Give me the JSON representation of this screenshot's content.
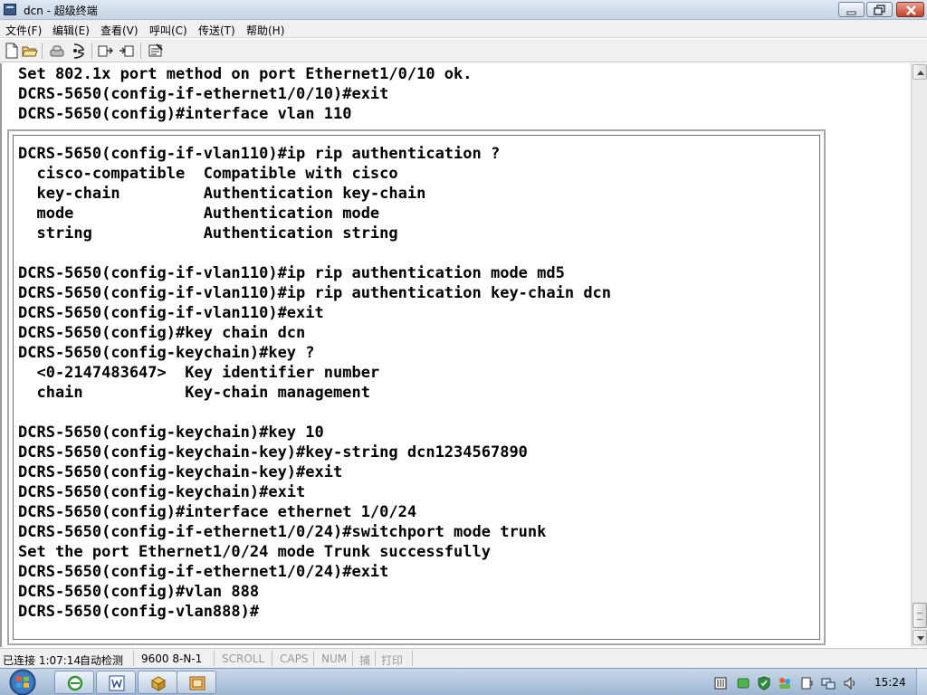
{
  "window": {
    "title": "dcn - 超级终端",
    "minimize_label": "",
    "maximize_label": "",
    "close_label": ""
  },
  "menu": {
    "items": [
      "文件(F)",
      "编辑(E)",
      "查看(V)",
      "呼叫(C)",
      "传送(T)",
      "帮助(H)"
    ]
  },
  "toolbar": {
    "buttons": [
      "new-icon",
      "open-icon",
      "disconnect-icon",
      "dial-icon",
      "send-icon",
      "receive-icon",
      "properties-icon"
    ]
  },
  "terminal": {
    "background_lines": [
      "Set 802.1x port method on port Ethernet1/0/10 ok.",
      "DCRS-5650(config-if-ethernet1/0/10)#exit",
      "DCRS-5650(config)#interface vlan 110"
    ],
    "inner_lines": [
      "DCRS-5650(config-if-vlan110)#ip rip authentication ?",
      "  cisco-compatible  Compatible with cisco",
      "  key-chain         Authentication key-chain",
      "  mode              Authentication mode",
      "  string            Authentication string",
      "",
      "DCRS-5650(config-if-vlan110)#ip rip authentication mode md5",
      "DCRS-5650(config-if-vlan110)#ip rip authentication key-chain dcn",
      "DCRS-5650(config-if-vlan110)#exit",
      "DCRS-5650(config)#key chain dcn",
      "DCRS-5650(config-keychain)#key ?",
      "  <0-2147483647>  Key identifier number",
      "  chain           Key-chain management",
      "",
      "DCRS-5650(config-keychain)#key 10",
      "DCRS-5650(config-keychain-key)#key-string dcn1234567890",
      "DCRS-5650(config-keychain-key)#exit",
      "DCRS-5650(config-keychain)#exit",
      "DCRS-5650(config)#interface ethernet 1/0/24",
      "DCRS-5650(config-if-ethernet1/0/24)#switchport mode trunk",
      "Set the port Ethernet1/0/24 mode Trunk successfully",
      "DCRS-5650(config-if-ethernet1/0/24)#exit",
      "DCRS-5650(config)#vlan 888",
      "DCRS-5650(config-vlan888)#"
    ]
  },
  "statusbar": {
    "connection": "已连接 1:07:14",
    "detect": "自动检测",
    "baud": "9600 8-N-1",
    "scroll": "SCROLL",
    "caps": "CAPS",
    "num": "NUM",
    "capture": "捕",
    "print": "打印"
  },
  "taskbar": {
    "clock": "15:24",
    "apps": [
      "ie-icon",
      "word-icon",
      "package-icon",
      "hyperterminal-icon"
    ]
  },
  "colors": {
    "terminal_bg": "#ffffff",
    "terminal_text": "#000000",
    "taskbar": "#b3c6de"
  }
}
